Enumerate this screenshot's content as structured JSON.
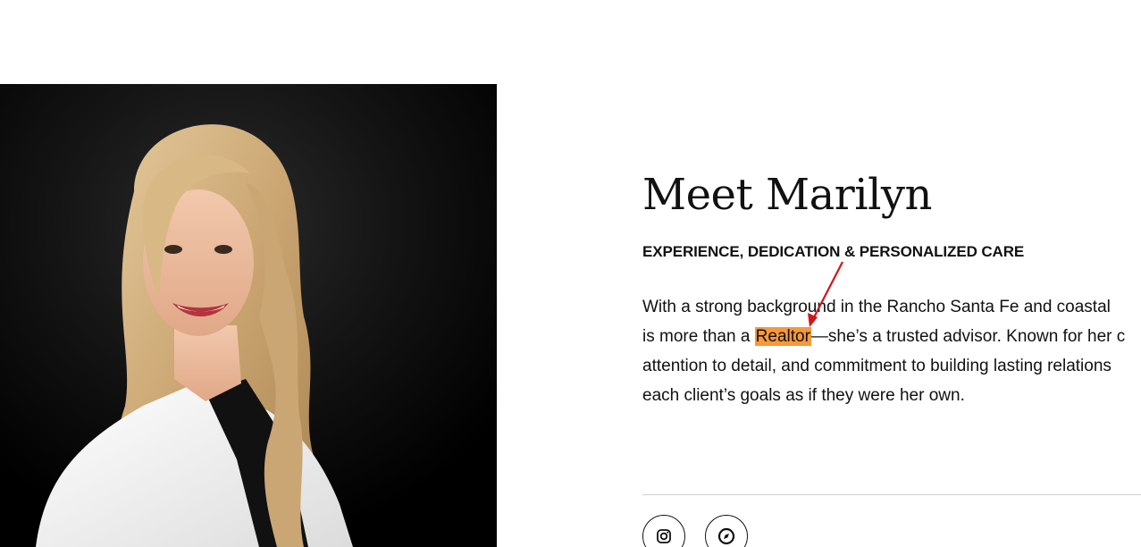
{
  "profile": {
    "photo_icon": "portrait-photo",
    "title": "Meet Marilyn",
    "subtitle": "EXPERIENCE, DEDICATION & PERSONALIZED CARE",
    "bio_lines": {
      "line1": "With a strong background in the Rancho Santa Fe and coastal",
      "line2_before": "is more than a ",
      "line2_highlight": "Realtor",
      "line2_after": "—she’s a trusted advisor. Known for her c",
      "line3": "attention to detail, and commitment to building lasting relations",
      "line4": "each client’s goals as if they were her own."
    }
  },
  "social": {
    "instagram_icon": "instagram-icon",
    "compass_icon": "compass-icon"
  },
  "colors": {
    "highlight": "#f7993a",
    "annotation_arrow": "#d0161c",
    "photo_background": "#000000",
    "divider": "#d0d0d0"
  }
}
